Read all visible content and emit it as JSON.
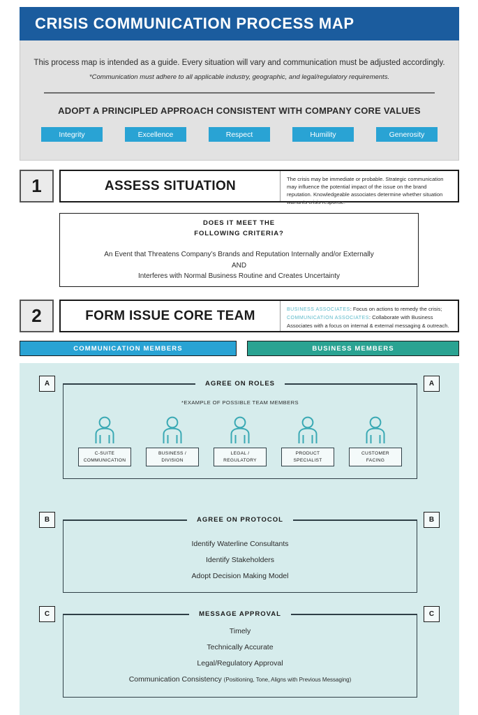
{
  "header": {
    "title": "CRISIS COMMUNICATION PROCESS MAP"
  },
  "intro": {
    "line1": "This process map is intended as a guide. Every situation will vary and communication must be adjusted accordingly.",
    "line2": "*Communication must adhere to all applicable industry, geographic, and legal/regulatory requirements.",
    "values_title": "ADOPT A PRINCIPLED APPROACH CONSISTENT WITH COMPANY CORE VALUES",
    "values": [
      "Integrity",
      "Excellence",
      "Respect",
      "Humility",
      "Generosity"
    ]
  },
  "step1": {
    "number": "1",
    "name": "ASSESS SITUATION",
    "description": "The crisis may be immediate or probable. Strategic communication may influence the potential impact of the issue on the brand reputation. Knowledgeable associates determine whether situation warrants crisis response."
  },
  "criteria": {
    "head_line1": "DOES IT MEET THE",
    "head_line2": "FOLLOWING CRITERIA?",
    "body_line1": "An Event that Threatens Company’s Brands and Reputation Internally and/or Externally",
    "body_line2": "AND",
    "body_line3": "Interferes with Normal Business Routine and Creates Uncertainty"
  },
  "step2": {
    "number": "2",
    "name": "FORM ISSUE CORE TEAM",
    "tag1": "BUSINESS ASSOCIATES",
    "desc1": ": Focus on actions to remedy the crisis;",
    "tag2": "COMMUNICATION ASSOCIATES",
    "desc2": ": Collaborate with Business Associates with a focus on internal & external messaging & outreach."
  },
  "member_bars": {
    "communication": "COMMUNICATION MEMBERS",
    "business": "BUSINESS MEMBERS"
  },
  "section_a": {
    "marker": "A",
    "title": "AGREE ON ROLES",
    "note": "*EXAMPLE OF POSSIBLE TEAM MEMBERS",
    "roles": [
      {
        "line1": "C-SUITE",
        "line2": "COMMUNICATION"
      },
      {
        "line1": "BUSINESS /",
        "line2": "DIVISION"
      },
      {
        "line1": "LEGAL /",
        "line2": "REGULATORY"
      },
      {
        "line1": "PRODUCT",
        "line2": "SPECIALIST"
      },
      {
        "line1": "CUSTOMER",
        "line2": "FACING"
      }
    ]
  },
  "section_b": {
    "marker": "B",
    "title": "AGREE ON PROTOCOL",
    "items": [
      "Identify Waterline Consultants",
      "Identify Stakeholders",
      "Adopt Decision Making Model"
    ]
  },
  "section_c": {
    "marker": "C",
    "title": "MESSAGE APPROVAL",
    "items": [
      "Timely",
      "Technically Accurate",
      "Legal/Regulatory Approval"
    ],
    "last_item_main": "Communication Consistency ",
    "last_item_paren": "(Positioning, Tone, Aligns with Previous Messaging)"
  },
  "colors": {
    "header_blue": "#1b5c9e",
    "chip_blue": "#29a3d4",
    "business_teal": "#2aa392",
    "panel_blue": "#d6ecec",
    "icon_teal": "#3aa9b4",
    "intro_gray": "#e2e2e2"
  }
}
